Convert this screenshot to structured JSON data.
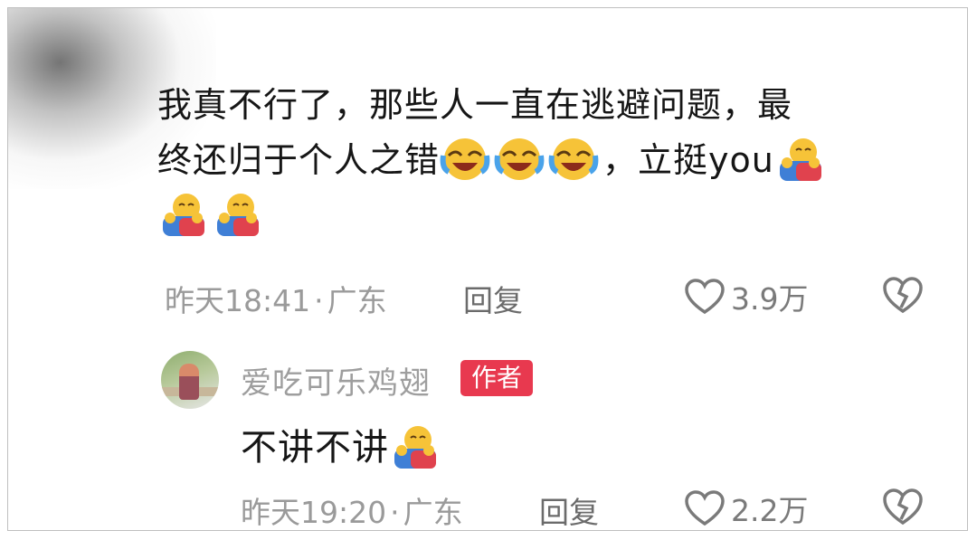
{
  "comment": {
    "text_line1": "我真不行了，那些人一直在逃避问题，最",
    "text_line2": "终还归于个人之错",
    "text_line2_suffix": "，立挺you",
    "emoji_laugh_cry": "laughing-crying-emoji",
    "emoji_hug": "hug-emoji",
    "time": "昨天18:41",
    "separator": "·",
    "location": "广东",
    "reply_label": "回复",
    "likes": "3.9万"
  },
  "reply_comment": {
    "username": "爱吃可乐鸡翅",
    "author_badge": "作者",
    "text": "不讲不讲",
    "time": "昨天19:20",
    "separator": "·",
    "location": "广东",
    "reply_label": "回复",
    "likes": "2.2万"
  },
  "colors": {
    "badge": "#e8394f",
    "meta_text": "#9a9a9a",
    "body_text": "#161616"
  }
}
